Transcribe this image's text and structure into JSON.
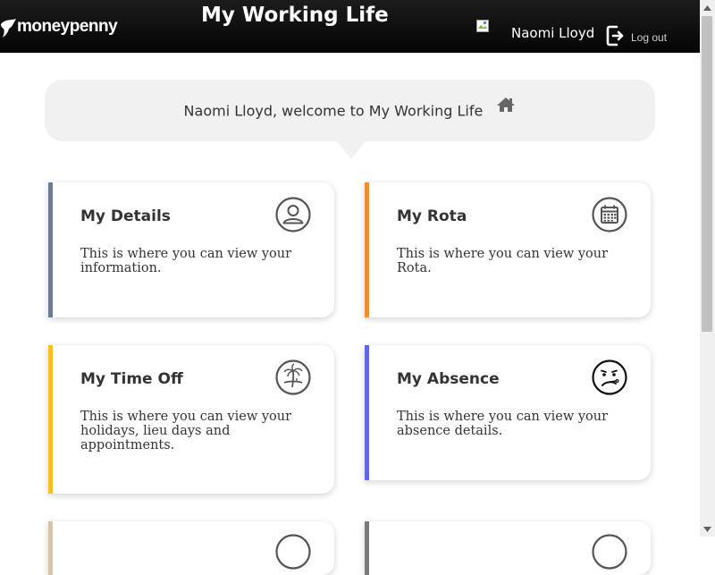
{
  "header": {
    "brand": "moneypenny",
    "title": "My Working Life",
    "user_name": "Naomi Lloyd",
    "logout_label": "Log out"
  },
  "welcome": {
    "text": "Naomi Lloyd, welcome to My Working Life",
    "icon": "home-icon"
  },
  "cards": [
    {
      "title": "My Details",
      "description": "This is where you can view your information.",
      "icon": "user-circle-icon",
      "accent": "#6f7a95"
    },
    {
      "title": "My Rota",
      "description": "This is where you can view your Rota.",
      "icon": "calendar-icon",
      "accent": "#f08c32"
    },
    {
      "title": "My Time Off",
      "description": "This is where you can view your holidays, lieu days and appointments.",
      "icon": "palm-tree-icon",
      "accent": "#f5c022"
    },
    {
      "title": "My Absence",
      "description": "This is where you can view your absence details.",
      "icon": "sick-face-icon",
      "accent": "#6464e6"
    }
  ],
  "partial_cards_accents": [
    "#d7c4ad",
    "#7b7b7b"
  ]
}
